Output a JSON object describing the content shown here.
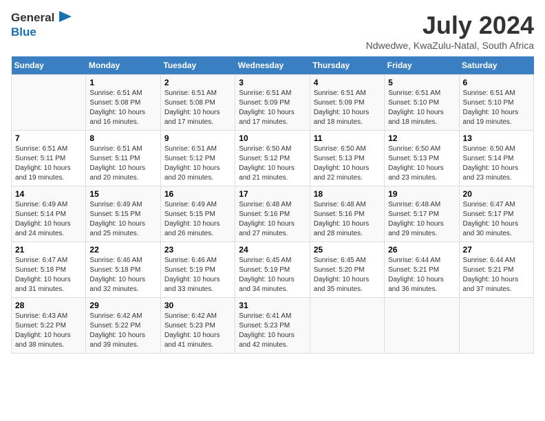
{
  "logo": {
    "general": "General",
    "blue": "Blue"
  },
  "title": "July 2024",
  "subtitle": "Ndwedwe, KwaZulu-Natal, South Africa",
  "days_of_week": [
    "Sunday",
    "Monday",
    "Tuesday",
    "Wednesday",
    "Thursday",
    "Friday",
    "Saturday"
  ],
  "weeks": [
    [
      {
        "day": "",
        "info": ""
      },
      {
        "day": "1",
        "info": "Sunrise: 6:51 AM\nSunset: 5:08 PM\nDaylight: 10 hours and 16 minutes."
      },
      {
        "day": "2",
        "info": "Sunrise: 6:51 AM\nSunset: 5:08 PM\nDaylight: 10 hours and 17 minutes."
      },
      {
        "day": "3",
        "info": "Sunrise: 6:51 AM\nSunset: 5:09 PM\nDaylight: 10 hours and 17 minutes."
      },
      {
        "day": "4",
        "info": "Sunrise: 6:51 AM\nSunset: 5:09 PM\nDaylight: 10 hours and 18 minutes."
      },
      {
        "day": "5",
        "info": "Sunrise: 6:51 AM\nSunset: 5:10 PM\nDaylight: 10 hours and 18 minutes."
      },
      {
        "day": "6",
        "info": "Sunrise: 6:51 AM\nSunset: 5:10 PM\nDaylight: 10 hours and 19 minutes."
      }
    ],
    [
      {
        "day": "7",
        "info": "Sunrise: 6:51 AM\nSunset: 5:11 PM\nDaylight: 10 hours and 19 minutes."
      },
      {
        "day": "8",
        "info": "Sunrise: 6:51 AM\nSunset: 5:11 PM\nDaylight: 10 hours and 20 minutes."
      },
      {
        "day": "9",
        "info": "Sunrise: 6:51 AM\nSunset: 5:12 PM\nDaylight: 10 hours and 20 minutes."
      },
      {
        "day": "10",
        "info": "Sunrise: 6:50 AM\nSunset: 5:12 PM\nDaylight: 10 hours and 21 minutes."
      },
      {
        "day": "11",
        "info": "Sunrise: 6:50 AM\nSunset: 5:13 PM\nDaylight: 10 hours and 22 minutes."
      },
      {
        "day": "12",
        "info": "Sunrise: 6:50 AM\nSunset: 5:13 PM\nDaylight: 10 hours and 23 minutes."
      },
      {
        "day": "13",
        "info": "Sunrise: 6:50 AM\nSunset: 5:14 PM\nDaylight: 10 hours and 23 minutes."
      }
    ],
    [
      {
        "day": "14",
        "info": "Sunrise: 6:49 AM\nSunset: 5:14 PM\nDaylight: 10 hours and 24 minutes."
      },
      {
        "day": "15",
        "info": "Sunrise: 6:49 AM\nSunset: 5:15 PM\nDaylight: 10 hours and 25 minutes."
      },
      {
        "day": "16",
        "info": "Sunrise: 6:49 AM\nSunset: 5:15 PM\nDaylight: 10 hours and 26 minutes."
      },
      {
        "day": "17",
        "info": "Sunrise: 6:48 AM\nSunset: 5:16 PM\nDaylight: 10 hours and 27 minutes."
      },
      {
        "day": "18",
        "info": "Sunrise: 6:48 AM\nSunset: 5:16 PM\nDaylight: 10 hours and 28 minutes."
      },
      {
        "day": "19",
        "info": "Sunrise: 6:48 AM\nSunset: 5:17 PM\nDaylight: 10 hours and 29 minutes."
      },
      {
        "day": "20",
        "info": "Sunrise: 6:47 AM\nSunset: 5:17 PM\nDaylight: 10 hours and 30 minutes."
      }
    ],
    [
      {
        "day": "21",
        "info": "Sunrise: 6:47 AM\nSunset: 5:18 PM\nDaylight: 10 hours and 31 minutes."
      },
      {
        "day": "22",
        "info": "Sunrise: 6:46 AM\nSunset: 5:18 PM\nDaylight: 10 hours and 32 minutes."
      },
      {
        "day": "23",
        "info": "Sunrise: 6:46 AM\nSunset: 5:19 PM\nDaylight: 10 hours and 33 minutes."
      },
      {
        "day": "24",
        "info": "Sunrise: 6:45 AM\nSunset: 5:19 PM\nDaylight: 10 hours and 34 minutes."
      },
      {
        "day": "25",
        "info": "Sunrise: 6:45 AM\nSunset: 5:20 PM\nDaylight: 10 hours and 35 minutes."
      },
      {
        "day": "26",
        "info": "Sunrise: 6:44 AM\nSunset: 5:21 PM\nDaylight: 10 hours and 36 minutes."
      },
      {
        "day": "27",
        "info": "Sunrise: 6:44 AM\nSunset: 5:21 PM\nDaylight: 10 hours and 37 minutes."
      }
    ],
    [
      {
        "day": "28",
        "info": "Sunrise: 6:43 AM\nSunset: 5:22 PM\nDaylight: 10 hours and 38 minutes."
      },
      {
        "day": "29",
        "info": "Sunrise: 6:42 AM\nSunset: 5:22 PM\nDaylight: 10 hours and 39 minutes."
      },
      {
        "day": "30",
        "info": "Sunrise: 6:42 AM\nSunset: 5:23 PM\nDaylight: 10 hours and 41 minutes."
      },
      {
        "day": "31",
        "info": "Sunrise: 6:41 AM\nSunset: 5:23 PM\nDaylight: 10 hours and 42 minutes."
      },
      {
        "day": "",
        "info": ""
      },
      {
        "day": "",
        "info": ""
      },
      {
        "day": "",
        "info": ""
      }
    ]
  ]
}
